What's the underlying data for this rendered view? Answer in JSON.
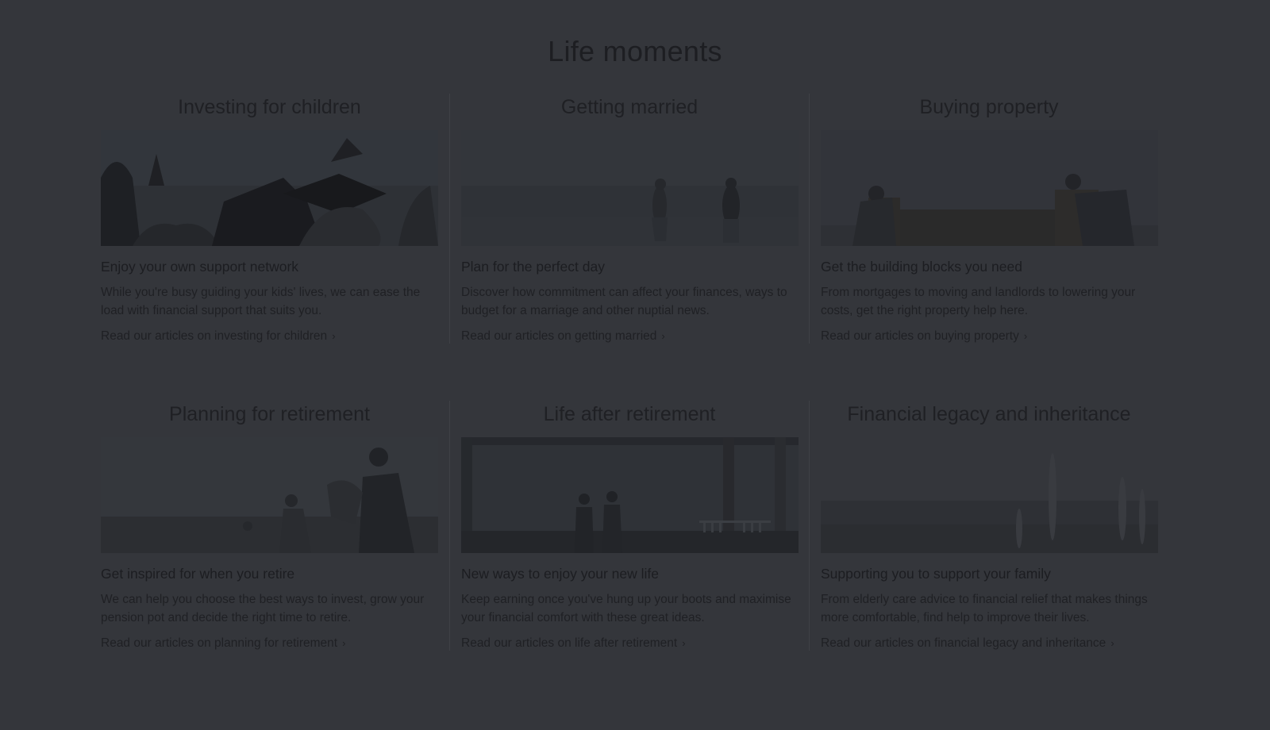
{
  "page": {
    "title": "Life moments"
  },
  "cards": [
    {
      "heading": "Investing for children",
      "subheading": "Enjoy your own support network",
      "body": "While you're busy guiding your kids' lives, we can ease the load with financial support that suits you.",
      "link": "Read our articles on investing for children",
      "link_chevron": "›"
    },
    {
      "heading": "Getting married",
      "subheading": "Plan for the perfect day",
      "body": "Discover how commitment can affect your finances, ways to budget for a marriage and other nuptial news.",
      "link": "Read our articles on getting married",
      "link_chevron": "›"
    },
    {
      "heading": "Buying property",
      "subheading": "Get the building blocks you need",
      "body": "From mortgages to moving and landlords to lowering your costs, get the right property help here.",
      "link": "Read our articles on buying property",
      "link_chevron": "›"
    },
    {
      "heading": "Planning for retirement",
      "subheading": "Get inspired for when you retire",
      "body": "We can help you choose the best ways to invest, grow your pension pot and decide the right time to retire.",
      "link": "Read our articles on planning for retirement",
      "link_chevron": "›"
    },
    {
      "heading": "Life after retirement",
      "subheading": "New ways to enjoy your new life",
      "body": "Keep earning once you've hung up your boots and maximise your financial comfort with these great ideas.",
      "link": "Read our articles on life after retirement",
      "link_chevron": "›"
    },
    {
      "heading": "Financial legacy and inheritance",
      "subheading": "Supporting you to support your family",
      "body": "From elderly care advice to financial relief that makes things more comfortable, find help to improve their lives.",
      "link": "Read our articles on financial legacy and inheritance",
      "link_chevron": "›"
    }
  ],
  "colors": {
    "overlay_bg": "#34363b",
    "text": "#1c1d20"
  }
}
